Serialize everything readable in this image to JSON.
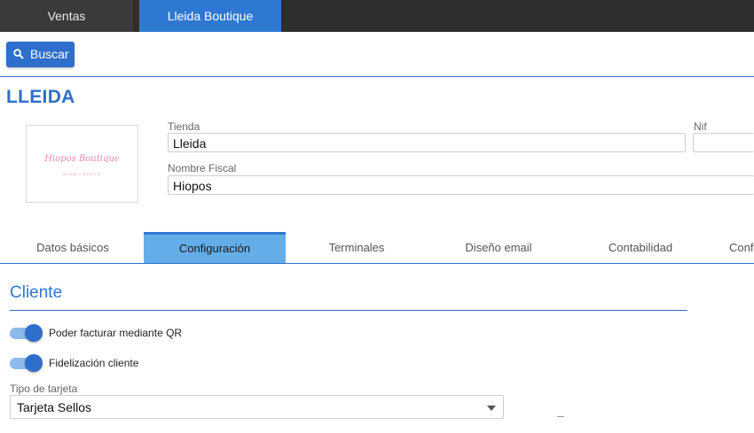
{
  "top_tabs": [
    {
      "label": "Ventas"
    },
    {
      "label": "Lleida Boutique"
    }
  ],
  "search_button": {
    "label": "Buscar",
    "icon": "search-icon"
  },
  "store_title": "LLEIDA",
  "logo": {
    "text": "Hiopos Boutique",
    "subtext": "MODA • ESTILO"
  },
  "fields": {
    "tienda": {
      "label": "Tienda",
      "value": "Lleida"
    },
    "nif": {
      "label": "Nif",
      "value": ""
    },
    "nombre_fiscal": {
      "label": "Nombre Fiscal",
      "value": "Hiopos"
    }
  },
  "section_tabs": [
    {
      "label": "Datos básicos"
    },
    {
      "label": "Configuración"
    },
    {
      "label": "Terminales"
    },
    {
      "label": "Diseño email"
    },
    {
      "label": "Contabilidad"
    },
    {
      "label": "Conf"
    }
  ],
  "active_section_tab": "Configuración",
  "section_title": "Cliente",
  "toggles": [
    {
      "label": "Poder facturar mediante QR",
      "on": true
    },
    {
      "label": "Fidelización cliente",
      "on": true
    }
  ],
  "tipo_tarjeta": {
    "label": "Tipo de tarjeta",
    "value": "Tarjeta Sellos"
  },
  "colors": {
    "accent": "#2f6fcc",
    "active_tab": "#63aee8",
    "topbar": "#2e2e2e"
  }
}
